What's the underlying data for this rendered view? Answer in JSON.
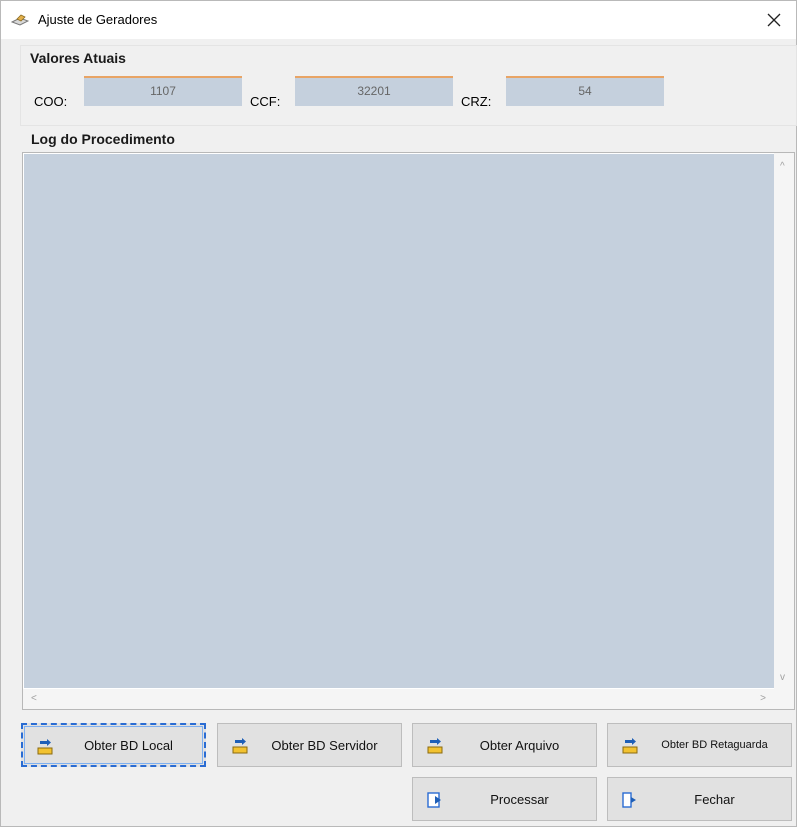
{
  "window": {
    "title": "Ajuste de Geradores",
    "close_glyph": "close-icon"
  },
  "valores": {
    "title": "Valores Atuais",
    "coo_label": "COO:",
    "coo_value": "1107",
    "ccf_label": "CCF:",
    "ccf_value": "32201",
    "crz_label": "CRZ:",
    "crz_value": "54"
  },
  "log": {
    "title": "Log do Procedimento",
    "scroll_up": "^",
    "scroll_down": "v",
    "scroll_left": "<",
    "scroll_right": ">"
  },
  "buttons": {
    "obter_bd_local": "Obter BD Local",
    "obter_bd_servidor": "Obter BD Servidor",
    "obter_arquivo": "Obter Arquivo",
    "obter_bd_retaguarda": "Obter BD Retaguarda",
    "processar": "Processar",
    "fechar": "Fechar"
  },
  "colors": {
    "field_bg": "#c5d0dd",
    "field_accent": "#e8a465",
    "log_bg": "#c5d0dd",
    "focus": "#2a6cd3"
  }
}
